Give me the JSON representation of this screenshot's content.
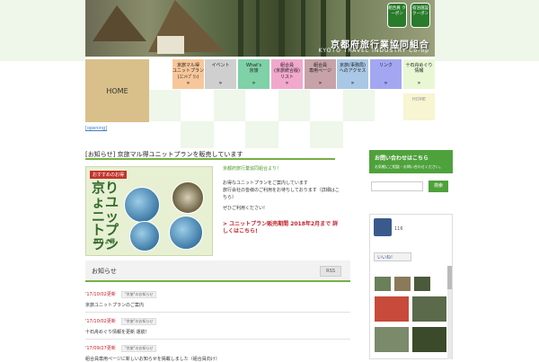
{
  "header": {
    "title": "京都府旅行業協同組合",
    "subtitle": "KYOTO TRAVEL INDUSTRY Co-op",
    "badge_left": "組合員\nクーポン",
    "badge_right": "宿泊施設\nクーポン"
  },
  "nav": {
    "home_label": "HOME",
    "items": [
      {
        "label": "京旅マル得\nユニットプラン\n(ﾕﾆｯﾄﾌﾟﾗﾝ)",
        "color": "#f7c79a"
      },
      {
        "label": "イベント",
        "color": "#cfcfcf"
      },
      {
        "label": "What's\n京旅",
        "color": "#7fd1a7"
      },
      {
        "label": "組合員\n(京旅統合版)\nリスト",
        "color": "#f2a8cd"
      },
      {
        "label": "組合員\n専用ページ",
        "color": "#c7a2a8"
      },
      {
        "label": "京旅(事務局)\nへのアクセス",
        "color": "#a9c8e6"
      },
      {
        "label": "リンク",
        "color": "#a3a7f2"
      },
      {
        "label": "十石舟めぐり\n情報",
        "color": "#e9f7d5"
      }
    ],
    "arrow": "»",
    "home2_label": "HOME"
  },
  "opening_link": "[opening]",
  "post": {
    "title": "[お知らせ] 京旅マル得ユニットプランを販売しています",
    "promo_tag": "おすすめのお得",
    "promo_main": "京りょユニットプラン",
    "promo_sub": "京りょ得",
    "headline": "京都府旅行業協同組合より！",
    "body1": "お得なユニットプランをご案内しています",
    "body2": "旅行会社の皆様のご利用をお待ちしております（詳細はこちら）",
    "body3": "ぜひご利用ください!",
    "notice": "> ユニットプラン販売期間 2018年2月まで 詳しくはこちら!"
  },
  "news": {
    "title": "お知らせ",
    "rss_label": "RSS",
    "items": [
      {
        "date": "'17/10/02更新",
        "category": "\"京旅\"のお知らせ",
        "text": "京旅ユニットプランのご案内"
      },
      {
        "date": "'17/10/02更新",
        "category": "\"京旅\"のお知らせ",
        "text": "十石舟めぐり情報を更新 運航!"
      },
      {
        "date": "'17/09/27更新",
        "category": "\"京旅\"のお知らせ",
        "text": "組合員専用ページに新しいお知らせを掲載しました（組合員向け）"
      }
    ]
  },
  "sidebar": {
    "contact_title": "お問い合わせはこちら",
    "contact_sub": "お気軽にご相談・お問い合わせください。",
    "search_placeholder": "",
    "search_button": "検索",
    "fb_count": "116",
    "fb_like": "いいね!"
  }
}
